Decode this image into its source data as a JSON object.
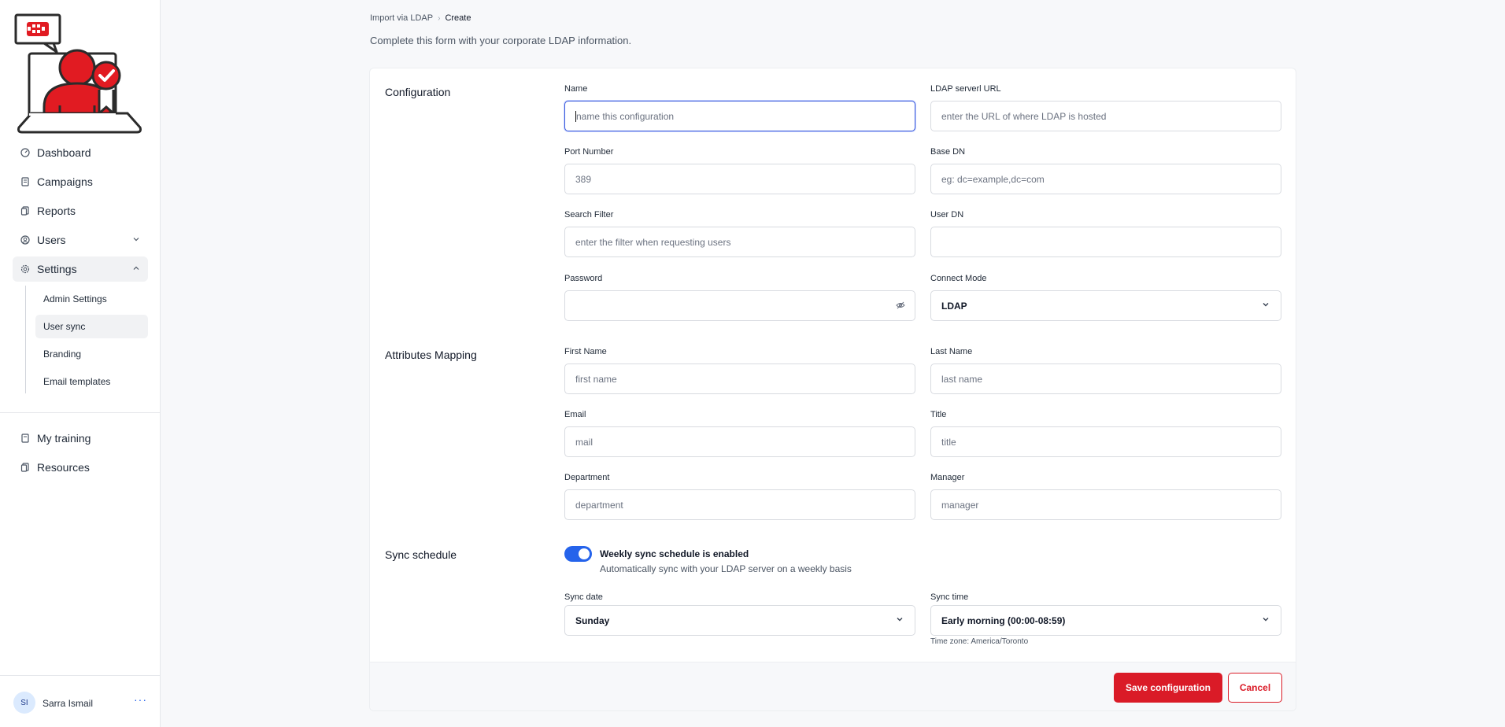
{
  "sidebar": {
    "nav": [
      {
        "label": "Dashboard",
        "icon": "dashboard-icon"
      },
      {
        "label": "Campaigns",
        "icon": "campaigns-icon"
      },
      {
        "label": "Reports",
        "icon": "reports-icon"
      },
      {
        "label": "Users",
        "icon": "users-icon"
      },
      {
        "label": "Settings",
        "icon": "settings-icon"
      }
    ],
    "settings_sub": [
      {
        "label": "Admin Settings"
      },
      {
        "label": "User sync"
      },
      {
        "label": "Branding"
      },
      {
        "label": "Email templates"
      }
    ],
    "nav2": [
      {
        "label": "My training",
        "icon": "training-icon"
      },
      {
        "label": "Resources",
        "icon": "resources-icon"
      }
    ],
    "user": {
      "initials": "SI",
      "name": "Sarra Ismail",
      "more": "···"
    }
  },
  "breadcrumb": {
    "parent": "Import via LDAP",
    "sep": "›",
    "current": "Create"
  },
  "subtitle": "Complete this form with your corporate LDAP information.",
  "sections": {
    "configuration": "Configuration",
    "attributes": "Attributes Mapping",
    "schedule": "Sync schedule"
  },
  "fields": {
    "name": {
      "label": "Name",
      "placeholder": "name this configuration"
    },
    "ldap_url": {
      "label": "LDAP serverl URL",
      "placeholder": "enter the URL of where LDAP is hosted"
    },
    "port": {
      "label": "Port Number",
      "placeholder": "389"
    },
    "base_dn": {
      "label": "Base DN",
      "placeholder": "eg: dc=example,dc=com"
    },
    "search_filter": {
      "label": "Search Filter",
      "placeholder": "enter the filter when requesting users"
    },
    "user_dn": {
      "label": "User DN",
      "placeholder": ""
    },
    "password": {
      "label": "Password",
      "placeholder": ""
    },
    "connect_mode": {
      "label": "Connect Mode",
      "value": "LDAP"
    },
    "first_name": {
      "label": "First Name",
      "placeholder": "first name"
    },
    "last_name": {
      "label": "Last Name",
      "placeholder": "last name"
    },
    "email": {
      "label": "Email",
      "placeholder": "mail"
    },
    "title": {
      "label": "Title",
      "placeholder": "title"
    },
    "department": {
      "label": "Department",
      "placeholder": "department"
    },
    "manager": {
      "label": "Manager",
      "placeholder": "manager"
    },
    "sync_date": {
      "label": "Sync date",
      "value": "Sunday"
    },
    "sync_time": {
      "label": "Sync time",
      "value": "Early morning (00:00-08:59)"
    }
  },
  "schedule": {
    "enabled": true,
    "title": "Weekly sync schedule is enabled",
    "description": "Automatically sync with your LDAP server on a weekly basis",
    "timezone": "Time zone: America/Toronto"
  },
  "buttons": {
    "save": "Save configuration",
    "cancel": "Cancel"
  },
  "colors": {
    "brand": "#da1b27",
    "accent": "#2563eb"
  }
}
